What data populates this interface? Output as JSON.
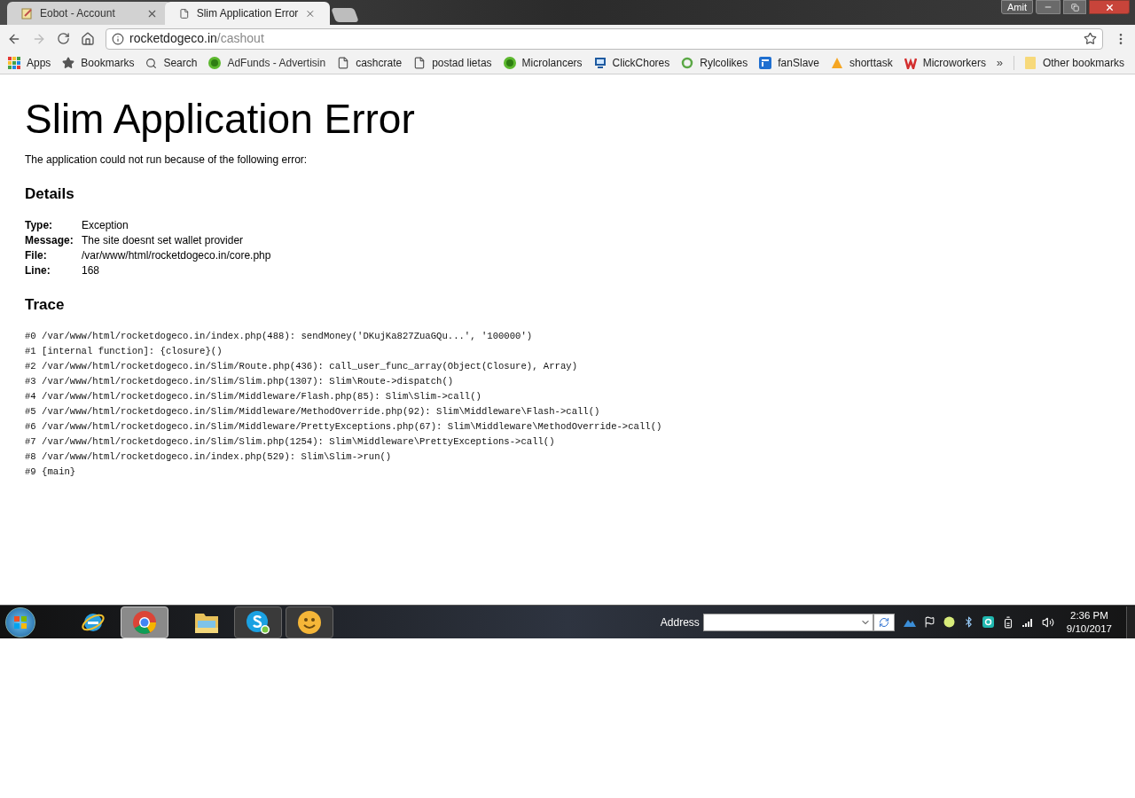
{
  "tabs": [
    {
      "title": "Eobot - Account",
      "selected": false
    },
    {
      "title": "Slim Application Error",
      "selected": true
    }
  ],
  "profile": "Amit",
  "address_bar": {
    "host": "rocketdogeco.in",
    "path": "/cashout"
  },
  "bookmarks": [
    {
      "label": "Apps",
      "kind": "apps"
    },
    {
      "label": "Bookmarks",
      "kind": "star"
    },
    {
      "label": "Search",
      "kind": "search"
    },
    {
      "label": "AdFunds - Advertisin",
      "kind": "coin"
    },
    {
      "label": "cashcrate",
      "kind": "page"
    },
    {
      "label": "postad lietas",
      "kind": "page"
    },
    {
      "label": "Microlancers",
      "kind": "coin"
    },
    {
      "label": "ClickChores",
      "kind": "monitor"
    },
    {
      "label": "Rylcolikes",
      "kind": "ring"
    },
    {
      "label": "fanSlave",
      "kind": "square"
    },
    {
      "label": "shorttask",
      "kind": "bee"
    },
    {
      "label": "Microworkers",
      "kind": "w"
    }
  ],
  "bookmarks_overflow": "»",
  "other_bookmarks": "Other bookmarks",
  "page": {
    "title": "Slim Application Error",
    "intro": "The application could not run because of the following error:",
    "details_heading": "Details",
    "details": [
      {
        "label": "Type:",
        "value": "Exception"
      },
      {
        "label": "Message:",
        "value": "The site doesnt set wallet provider"
      },
      {
        "label": "File:",
        "value": "/var/www/html/rocketdogeco.in/core.php"
      },
      {
        "label": "Line:",
        "value": "168"
      }
    ],
    "trace_heading": "Trace",
    "trace": [
      "#0 /var/www/html/rocketdogeco.in/index.php(488): sendMoney('DKujKa827ZuaGQu...', '100000')",
      "#1 [internal function]: {closure}()",
      "#2 /var/www/html/rocketdogeco.in/Slim/Route.php(436): call_user_func_array(Object(Closure), Array)",
      "#3 /var/www/html/rocketdogeco.in/Slim/Slim.php(1307): Slim\\Route->dispatch()",
      "#4 /var/www/html/rocketdogeco.in/Slim/Middleware/Flash.php(85): Slim\\Slim->call()",
      "#5 /var/www/html/rocketdogeco.in/Slim/Middleware/MethodOverride.php(92): Slim\\Middleware\\Flash->call()",
      "#6 /var/www/html/rocketdogeco.in/Slim/Middleware/PrettyExceptions.php(67): Slim\\Middleware\\MethodOverride->call()",
      "#7 /var/www/html/rocketdogeco.in/Slim/Slim.php(1254): Slim\\Middleware\\PrettyExceptions->call()",
      "#8 /var/www/html/rocketdogeco.in/index.php(529): Slim\\Slim->run()",
      "#9 {main}"
    ]
  },
  "taskbar": {
    "apps": [
      {
        "kind": "ie",
        "selected": false
      },
      {
        "kind": "chrome",
        "selected": true
      },
      {
        "kind": "folder",
        "selected": false
      },
      {
        "kind": "skype",
        "selected": false
      },
      {
        "kind": "smiley",
        "selected": false
      }
    ],
    "address_label": "Address",
    "time": "2:36 PM",
    "date": "9/10/2017"
  }
}
